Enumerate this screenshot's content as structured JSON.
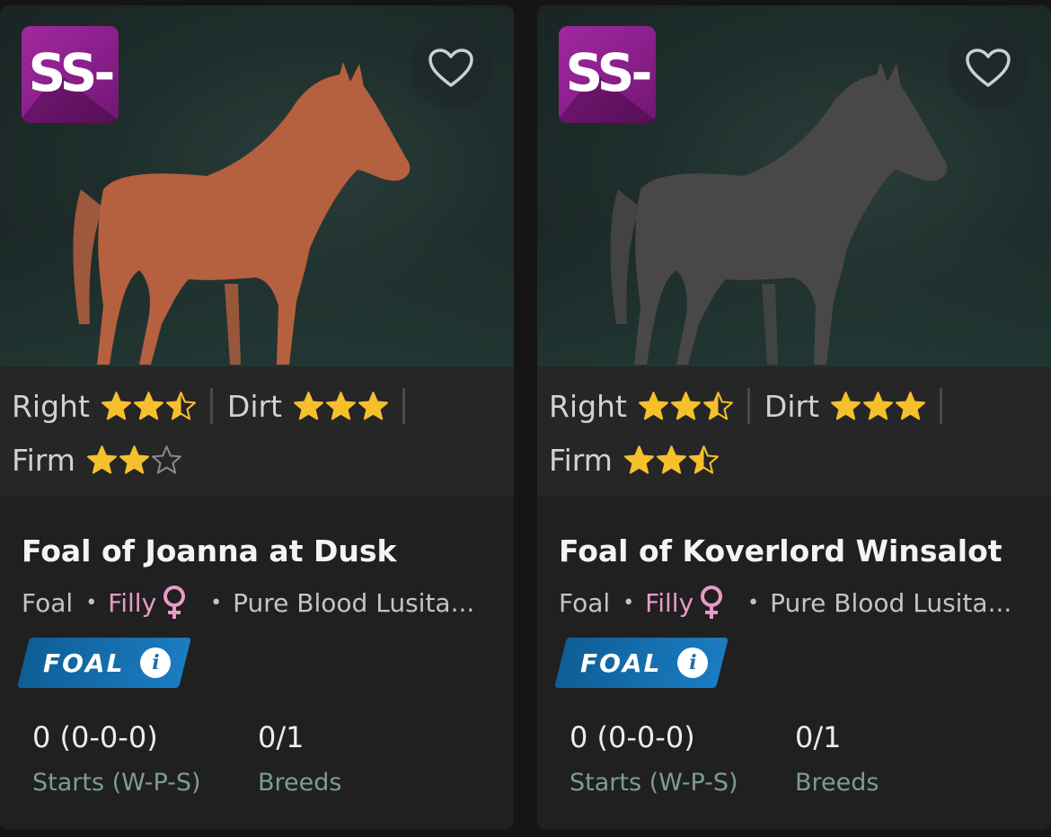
{
  "cards": [
    {
      "grade": "SS-",
      "horse_color": "#b5603f",
      "surfaces": [
        {
          "label": "Right",
          "rating": 2.5
        },
        {
          "label": "Dirt",
          "rating": 3
        },
        {
          "label": "Firm",
          "rating": 2
        }
      ],
      "name": "Foal of Joanna at Dusk",
      "age_class": "Foal",
      "gender": "Filly",
      "breed": "Pure Blood Lusita...",
      "badge": "FOAL",
      "stats": [
        {
          "value": "0 (0-0-0)",
          "label": "Starts (W-P-S)"
        },
        {
          "value": "0/1",
          "label": "Breeds"
        }
      ]
    },
    {
      "grade": "SS-",
      "horse_color": "#4a4846",
      "surfaces": [
        {
          "label": "Right",
          "rating": 2.5
        },
        {
          "label": "Dirt",
          "rating": 3
        },
        {
          "label": "Firm",
          "rating": 2.5
        }
      ],
      "name": "Foal of Koverlord Winsalot",
      "age_class": "Foal",
      "gender": "Filly",
      "breed": "Pure Blood Lusita...",
      "badge": "FOAL",
      "stats": [
        {
          "value": "0 (0-0-0)",
          "label": "Starts (W-P-S)"
        },
        {
          "value": "0/1",
          "label": "Breeds"
        }
      ]
    }
  ],
  "colors": {
    "star": "#f5c02b",
    "grade_bg": "#9a2697",
    "badge_bg": "#1570b0",
    "gender": "#e99ac8",
    "stat_label": "#7e9c92"
  },
  "icons": {
    "favorite": "heart-outline-icon",
    "gender": "female-symbol-icon",
    "info": "info-icon",
    "rating": "star-icon"
  }
}
